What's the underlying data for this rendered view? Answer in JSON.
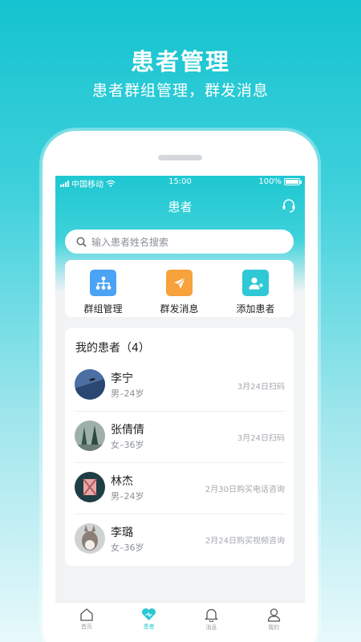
{
  "hero": {
    "title": "患者管理",
    "subtitle": "患者群组管理，群发消息"
  },
  "status_bar": {
    "carrier": "中国移动",
    "time": "15:00",
    "battery": "100%"
  },
  "navbar": {
    "title": "患者"
  },
  "search": {
    "placeholder": "输入患者姓名搜索"
  },
  "actions": [
    {
      "label": "群组管理",
      "icon": "group-tree-icon",
      "color": "#4aa3f5"
    },
    {
      "label": "群发消息",
      "icon": "paper-plane-icon",
      "color": "#f7a23b"
    },
    {
      "label": "添加患者",
      "icon": "add-user-icon",
      "color": "#2fc8d6"
    }
  ],
  "patients": {
    "title": "我的患者（4）",
    "items": [
      {
        "name": "李宁",
        "info": "男–24岁",
        "note": "3月24日扫码"
      },
      {
        "name": "张倩倩",
        "info": "女–36岁",
        "note": "3月24日扫码"
      },
      {
        "name": "林杰",
        "info": "男–24岁",
        "note": "2月30日购买电话咨询"
      },
      {
        "name": "李璐",
        "info": "女–36岁",
        "note": "2月24日购买视频咨询"
      }
    ]
  },
  "tabbar": {
    "active_color": "#29c7d3",
    "items": [
      {
        "label": "首页",
        "icon": "home-icon"
      },
      {
        "label": "患者",
        "icon": "heart-icon"
      },
      {
        "label": "消息",
        "icon": "bell-icon"
      },
      {
        "label": "我的",
        "icon": "user-icon"
      }
    ]
  }
}
